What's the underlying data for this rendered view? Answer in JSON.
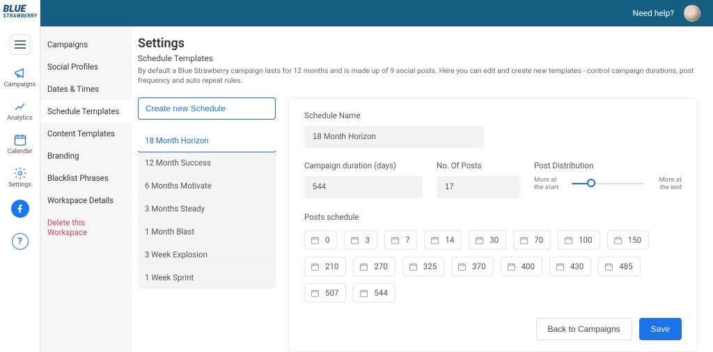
{
  "brand": {
    "name": "BLUE",
    "sub": "STRAWBERRY"
  },
  "topbar": {
    "help": "Need help?"
  },
  "rail": {
    "campaigns": "Campaigns",
    "analytics": "Analytics",
    "calendar": "Calendar",
    "settings": "Settings"
  },
  "sidebar": {
    "items": [
      "Campaigns",
      "Social Profiles",
      "Dates & Times",
      "Schedule Templates",
      "Content Templates",
      "Branding",
      "Blacklist Phrases",
      "Workspace Details",
      "Delete this Workspace"
    ],
    "active_index": 3,
    "danger_index": 8
  },
  "page": {
    "title": "Settings",
    "subtitle": "Schedule Templates",
    "description": "By default a Blue Strawberry campaign lasts for 12 months and is made up of 9 social posts. Here you can edit and create new templates - control campaign durations, post frequency and auto repeat rules."
  },
  "schedules": {
    "create_label": "Create new Schedule",
    "items": [
      "18 Month Horizon",
      "12 Month Success",
      "6 Months Motivate",
      "3 Months Steady",
      "1 Month Blast",
      "3 Week Explosion",
      "1 Week Sprint"
    ],
    "selected_index": 0
  },
  "form": {
    "name_label": "Schedule Name",
    "name_value": "18 Month Horizon",
    "duration_label": "Campaign duration (days)",
    "duration_value": "544",
    "posts_label": "No. Of Posts",
    "posts_value": "17",
    "dist_label": "Post Distribution",
    "dist_left": "More at the start",
    "dist_right": "More at the end",
    "dist_percent": 27,
    "schedule_label": "Posts schedule",
    "days": [
      "0",
      "3",
      "7",
      "14",
      "30",
      "70",
      "100",
      "150",
      "210",
      "270",
      "325",
      "370",
      "400",
      "430",
      "485",
      "507",
      "544"
    ]
  },
  "actions": {
    "back": "Back to Campaigns",
    "save": "Save"
  }
}
